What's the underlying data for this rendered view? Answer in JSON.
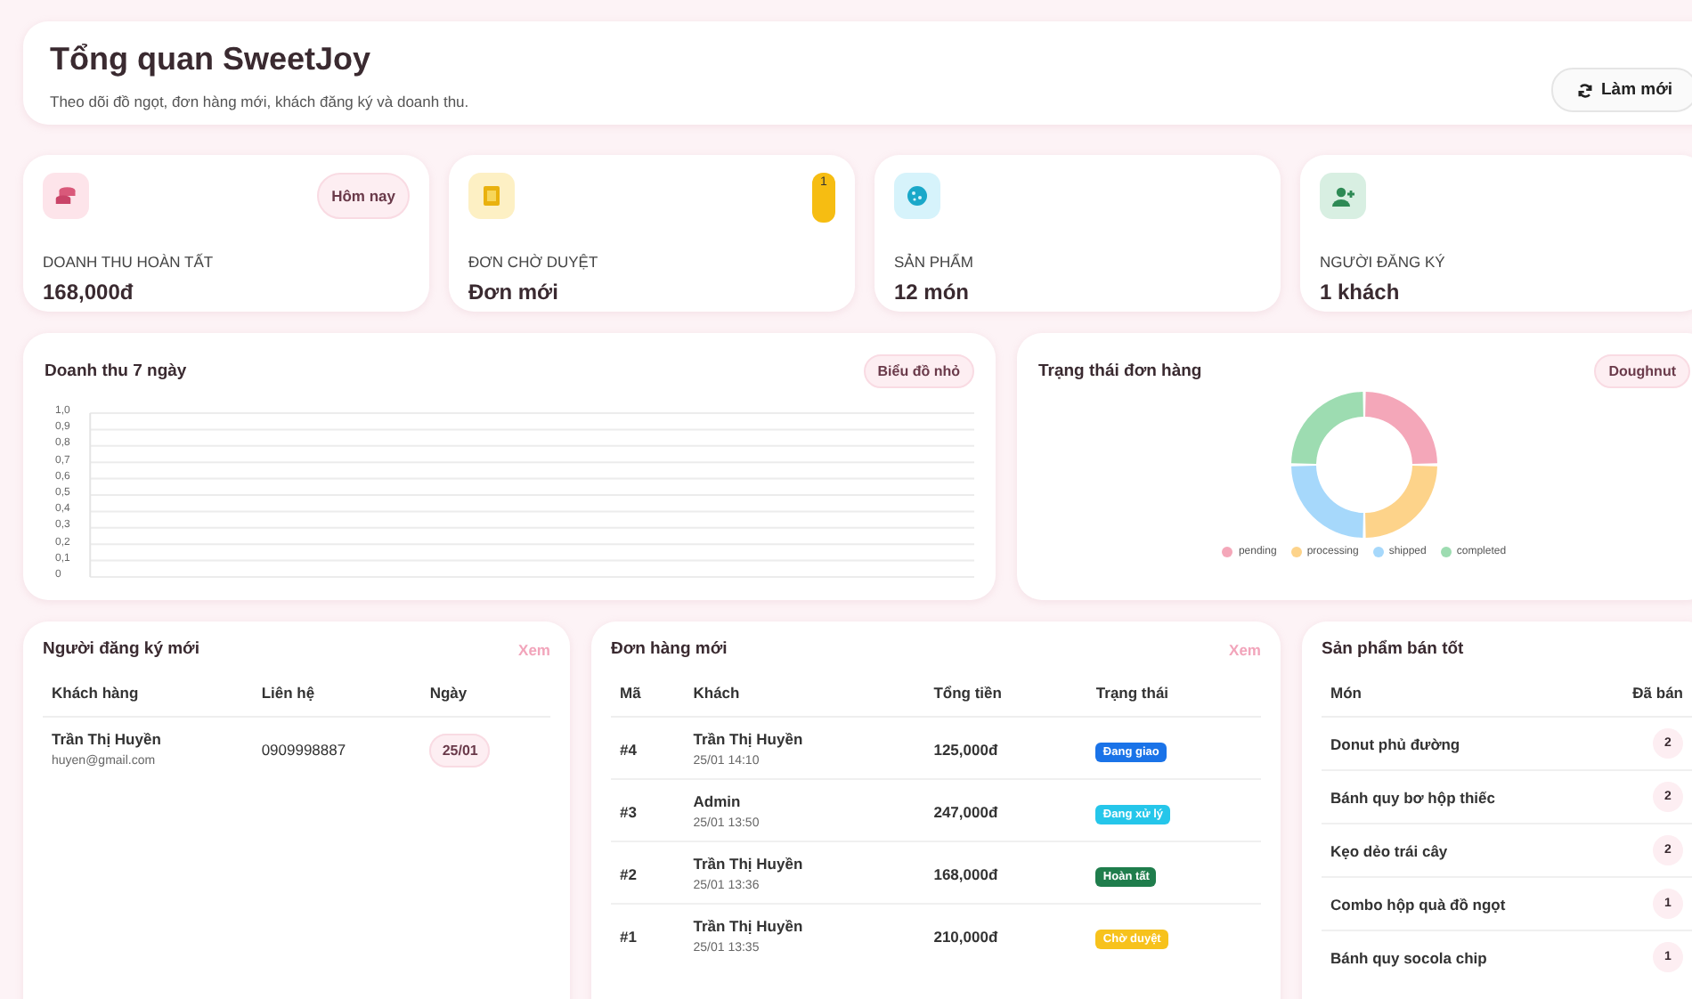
{
  "header": {
    "title": "Tổng quan SweetJoy",
    "subtitle": "Theo dõi đồ ngọt, đơn hàng mới, khách đăng ký và doanh thu.",
    "refresh_button": "Làm mới"
  },
  "stats": [
    {
      "kind": "revenue",
      "label": "DOANH THU HOÀN TẤT",
      "value": "168,000đ",
      "badge": "Hôm nay"
    },
    {
      "kind": "orders",
      "label": "ĐƠN CHỜ DUYỆT",
      "value": "Đơn mới",
      "count": "1"
    },
    {
      "kind": "products",
      "label": "SẢN PHẨM",
      "value": "12 món"
    },
    {
      "kind": "users",
      "label": "NGƯỜI ĐĂNG KÝ",
      "value": "1 khách"
    }
  ],
  "revenue_chart": {
    "badge": "Biểu đồ nhỏ",
    "chart_data": {
      "type": "line",
      "title": "Doanh thu 7 ngày",
      "categories": [
        null,
        null,
        null,
        null,
        null,
        null,
        null
      ],
      "grid": true,
      "ylim": [
        0,
        1
      ],
      "yticks": [
        {
          "value": 0,
          "label": "0"
        },
        {
          "value": 0.1,
          "label": "0,1"
        },
        {
          "value": 0.2,
          "label": "0,2"
        },
        {
          "value": 0.3,
          "label": "0,3"
        },
        {
          "value": 0.4,
          "label": "0,4"
        },
        {
          "value": 0.5,
          "label": "0,5"
        },
        {
          "value": 0.6,
          "label": "0,6"
        },
        {
          "value": 0.7,
          "label": "0,7"
        },
        {
          "value": 0.8,
          "label": "0,8"
        },
        {
          "value": 0.9,
          "label": "0,9"
        },
        {
          "value": 1,
          "label": "1,0"
        }
      ]
    }
  },
  "status_chart": {
    "badge": "Doughnut",
    "chart_data": {
      "type": "donut",
      "title": "Trạng thái đơn hàng",
      "categories": [
        "pending",
        "processing",
        "shipped",
        "completed"
      ],
      "values": [
        25,
        25,
        25,
        25
      ],
      "colors": [
        "#f4a7b9",
        "#fdd38a",
        "#a6d8fb",
        "#9ddcb1"
      ],
      "legend": "bottom"
    }
  },
  "new_users": {
    "title": "Người đăng ký mới",
    "link": "Xem",
    "columns": [
      "Khách hàng",
      "Liên hệ",
      "Ngày"
    ],
    "rows": [
      {
        "name": "Trần Thị Huyền",
        "email": "huyen@gmail.com",
        "phone": "0909998887",
        "date": "25/01"
      }
    ]
  },
  "new_orders": {
    "title": "Đơn hàng mới",
    "link": "Xem",
    "columns": [
      "Mã",
      "Khách",
      "Tổng tiền",
      "Trạng thái"
    ],
    "rows": [
      {
        "id": "#4",
        "customer": "Trần Thị Huyền",
        "time": "25/01 14:10",
        "total": "125,000đ",
        "status": "Đang giao",
        "color": "#1a73e8"
      },
      {
        "id": "#3",
        "customer": "Admin",
        "time": "25/01 13:50",
        "total": "247,000đ",
        "status": "Đang xử lý",
        "color": "#25c6ea"
      },
      {
        "id": "#2",
        "customer": "Trần Thị Huyền",
        "time": "25/01 13:36",
        "total": "168,000đ",
        "status": "Hoàn tất",
        "color": "#1f7d4c"
      },
      {
        "id": "#1",
        "customer": "Trần Thị Huyền",
        "time": "25/01 13:35",
        "total": "210,000đ",
        "status": "Chờ duyệt",
        "color": "#f7c21c"
      }
    ]
  },
  "top_products": {
    "title": "Sản phẩm bán tốt",
    "columns": [
      "Món",
      "Đã bán"
    ],
    "rows": [
      {
        "name": "Donut phủ đường",
        "sold": "2"
      },
      {
        "name": "Bánh quy bơ hộp thiếc",
        "sold": "2"
      },
      {
        "name": "Kẹo dẻo trái cây",
        "sold": "2"
      },
      {
        "name": "Combo hộp quà đồ ngọt",
        "sold": "1"
      },
      {
        "name": "Bánh quy socola chip",
        "sold": "1"
      }
    ]
  }
}
